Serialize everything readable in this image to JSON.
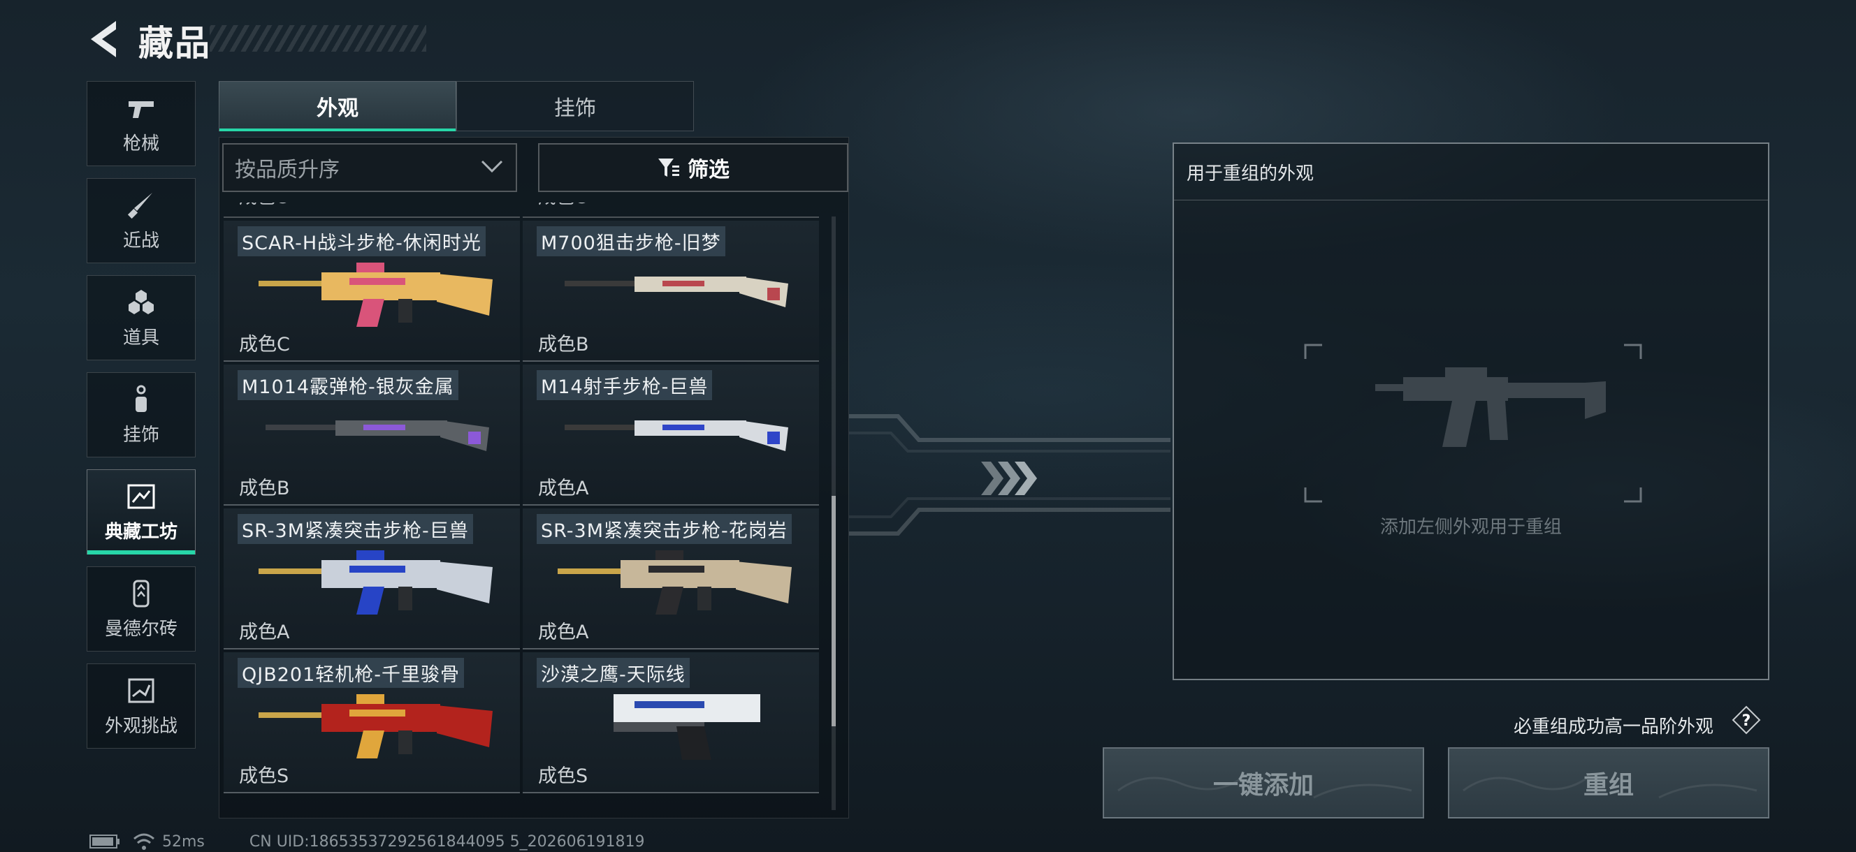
{
  "header": {
    "title": "藏品",
    "back_icon": "back-arrow-icon"
  },
  "nav": {
    "items": [
      {
        "label": "枪械",
        "icon": "pistol-icon",
        "active": false
      },
      {
        "label": "近战",
        "icon": "knife-icon",
        "active": false
      },
      {
        "label": "道具",
        "icon": "grenade-icon",
        "active": false
      },
      {
        "label": "挂饰",
        "icon": "charm-icon",
        "active": false
      },
      {
        "label": "典藏工坊",
        "icon": "workshop-icon",
        "active": true
      },
      {
        "label": "曼德尔砖",
        "icon": "brick-icon",
        "active": false
      },
      {
        "label": "外观挑战",
        "icon": "challenge-icon",
        "active": false
      }
    ]
  },
  "tabs": [
    {
      "label": "外观",
      "active": true
    },
    {
      "label": "挂饰",
      "active": false
    }
  ],
  "sort": {
    "value": "按品质升序"
  },
  "filter": {
    "label": "筛选"
  },
  "list": {
    "partial_top": [
      "成色C",
      "成色C"
    ],
    "items": [
      {
        "name": "SCAR-H战斗步枪-休闲时光",
        "grade": "成色C",
        "colors": [
          "#e8b860",
          "#d9547a"
        ]
      },
      {
        "name": "M700狙击步枪-旧梦",
        "grade": "成色B",
        "colors": [
          "#d8d2c2",
          "#b9474f"
        ]
      },
      {
        "name": "M1014霰弹枪-银灰金属",
        "grade": "成色B",
        "colors": [
          "#5b6065",
          "#8c59d8"
        ]
      },
      {
        "name": "M14射手步枪-巨兽",
        "grade": "成色A",
        "colors": [
          "#d7dbe0",
          "#2f45c8"
        ]
      },
      {
        "name": "SR-3M紧凑突击步枪-巨兽",
        "grade": "成色A",
        "colors": [
          "#c9d0da",
          "#2744c6"
        ]
      },
      {
        "name": "SR-3M紧凑突击步枪-花岗岩",
        "grade": "成色A",
        "colors": [
          "#c7b79a",
          "#2b2b2e"
        ]
      },
      {
        "name": "QJB201轻机枪-千里骏骨",
        "grade": "成色S",
        "colors": [
          "#b3231d",
          "#e0a63c"
        ]
      },
      {
        "name": "沙漠之鹰-天际线",
        "grade": "成色S",
        "colors": [
          "#e8ecef",
          "#2a4ab0"
        ]
      }
    ]
  },
  "reorg": {
    "header": "用于重组的外观",
    "placeholder": "添加左侧外观用于重组",
    "guarantee": "必重组成功高一品阶外观",
    "add_all_label": "一键添加",
    "reorg_label": "重组"
  },
  "status": {
    "ping": "52ms",
    "uid": "CN UID:18653537292561844095 5_202606191819"
  },
  "colors": {
    "accent": "#27d6a8"
  }
}
